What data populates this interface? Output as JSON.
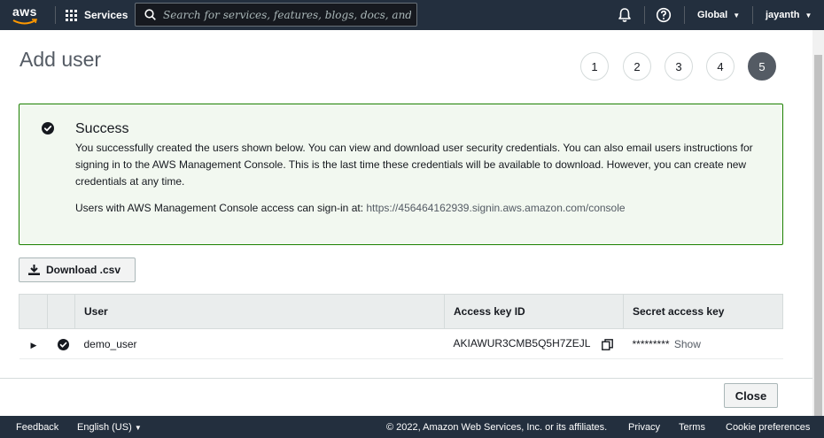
{
  "topnav": {
    "logo_text": "aws",
    "services_label": "Services",
    "search_placeholder": "Search for services, features, blogs, docs, and more",
    "region_label": "Global",
    "user_label": "jayanth"
  },
  "page": {
    "title": "Add user",
    "steps": [
      "1",
      "2",
      "3",
      "4",
      "5"
    ],
    "active_step": 5
  },
  "success": {
    "title": "Success",
    "message": "You successfully created the users shown below. You can view and download user security credentials. You can also email users instructions for signing in to the AWS Management Console. This is the last time these credentials will be available to download. However, you can create new credentials at any time.",
    "signin_prefix": "Users with AWS Management Console access can sign-in at: ",
    "signin_url": "https://456464162939.signin.aws.amazon.com/console"
  },
  "actions": {
    "download_label": "Download .csv",
    "close_label": "Close"
  },
  "table": {
    "headers": [
      "User",
      "Access key ID",
      "Secret access key"
    ],
    "rows": [
      {
        "user": "demo_user",
        "access_key_id": "AKIAWUR3CMB5Q5H7ZEJL",
        "secret_masked": "*********",
        "show_label": "Show"
      }
    ]
  },
  "footer": {
    "feedback": "Feedback",
    "language": "English (US)",
    "copyright": "© 2022, Amazon Web Services, Inc. or its affiliates.",
    "privacy": "Privacy",
    "terms": "Terms",
    "cookies": "Cookie preferences"
  },
  "colors": {
    "nav_bg": "#232f3e",
    "success_border": "#1d8102",
    "success_bg": "#f2f8f0",
    "active_step": "#545b64"
  }
}
